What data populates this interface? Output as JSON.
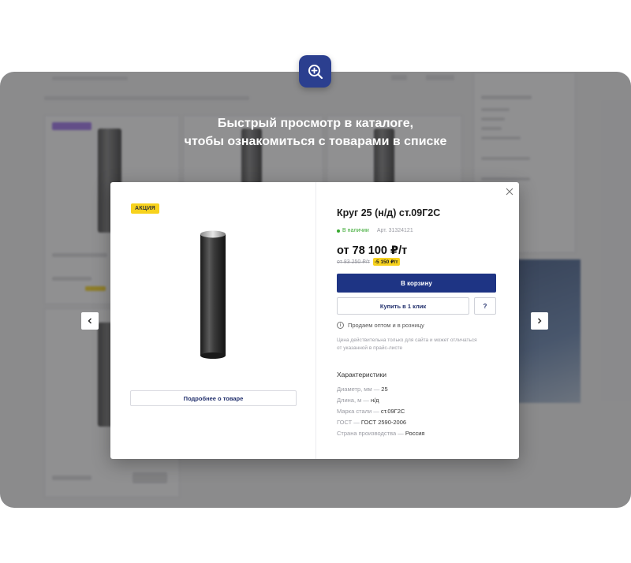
{
  "headline": {
    "line1": "Быстрый просмотр в каталоге,",
    "line2": "чтобы ознакомиться с товарами в списке"
  },
  "icons": {
    "zoom": "zoom-in-icon",
    "close": "close-icon",
    "prev": "chevron-left-icon",
    "next": "chevron-right-icon",
    "info": "info-icon"
  },
  "colors": {
    "accent": "#1e3484",
    "promo": "#f7d21d",
    "in_stock": "#37a82f"
  },
  "modal": {
    "promo_badge": "АКЦИЯ",
    "details_button": "Подробнее о товаре",
    "title": "Круг 25 (н/д) ст.09Г2С",
    "stock": "В наличии",
    "article": "Арт. 31324121",
    "price": "от 78 100 ₽/т",
    "old_price": "от 83 250 ₽/т",
    "discount": "-5 150 ₽/т",
    "cart_button": "В корзину",
    "oneclick_button": "Купить в 1 клик",
    "question_button": "?",
    "wholesale_note": "Продаем оптом и в розницу",
    "price_note": "Цена действительна только для сайта и может отличаться от указанной в прайс-листе",
    "characteristics_title": "Характеристики",
    "characteristics": [
      {
        "label": "Диаметр, мм — ",
        "value": "25"
      },
      {
        "label": "Длина, м — ",
        "value": "н/д"
      },
      {
        "label": "Марка стали — ",
        "value": "ст.09Г2С"
      },
      {
        "label": "ГОСТ — ",
        "value": "ГОСТ 2590-2006"
      },
      {
        "label": "Страна производства — ",
        "value": "Россия"
      }
    ]
  }
}
